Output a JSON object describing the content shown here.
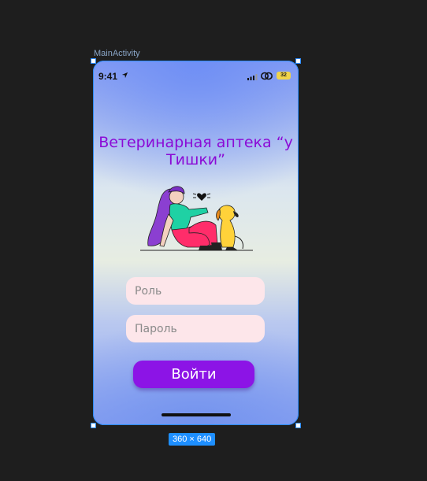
{
  "canvas": {
    "frame_label": "MainActivity",
    "size_badge": "360 × 640"
  },
  "status_bar": {
    "time": "9:41",
    "battery": "32"
  },
  "app": {
    "title": "Ветеринарная аптека “у Тишки”",
    "role_placeholder": "Роль",
    "password_placeholder": "Пароль",
    "login_label": "Войти"
  },
  "colors": {
    "accent": "#8c14e6",
    "title": "#8b0bd6",
    "field_bg": "#fde6ea",
    "selection": "#2d8cff"
  }
}
